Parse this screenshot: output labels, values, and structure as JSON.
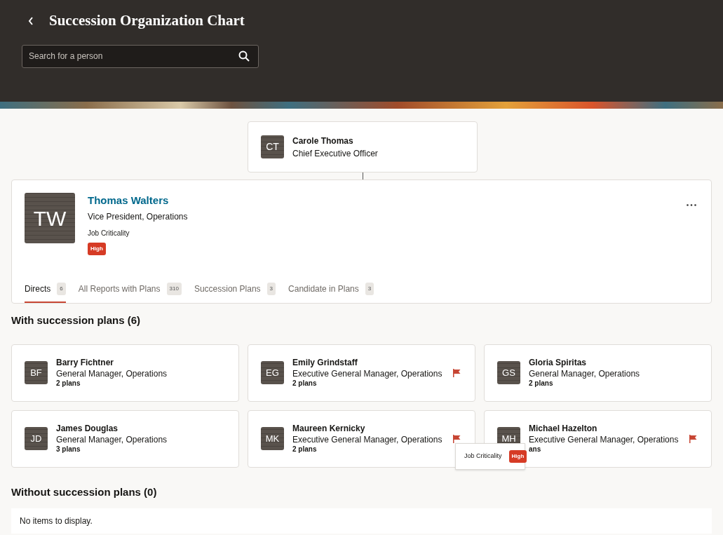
{
  "header": {
    "title": "Succession Organization Chart",
    "search": {
      "placeholder": "Search for a person"
    }
  },
  "manager": {
    "initials": "CT",
    "name": "Carole Thomas",
    "title": "Chief Executive Officer"
  },
  "person": {
    "initials": "TW",
    "name": "Thomas Walters",
    "title": "Vice President, Operations",
    "criticality_label": "Job Criticality",
    "criticality": "High"
  },
  "tabs": [
    {
      "label": "Directs",
      "count": "6",
      "selected": true
    },
    {
      "label": "All Reports with Plans",
      "count": "310",
      "selected": false
    },
    {
      "label": "Succession Plans",
      "count": "3",
      "selected": false
    },
    {
      "label": "Candidate in Plans",
      "count": "3",
      "selected": false
    }
  ],
  "with_plans": {
    "heading": "With succession plans (6)",
    "items": [
      {
        "initials": "BF",
        "name": "Barry Fichtner",
        "title": "General Manager, Operations",
        "plans": "2 plans",
        "flagged": false
      },
      {
        "initials": "EG",
        "name": "Emily Grindstaff",
        "title": "Executive General Manager, Operations",
        "plans": "2 plans",
        "flagged": true
      },
      {
        "initials": "GS",
        "name": "Gloria Spiritas",
        "title": "General Manager, Operations",
        "plans": "2 plans",
        "flagged": false
      },
      {
        "initials": "JD",
        "name": "James Douglas",
        "title": "General Manager, Operations",
        "plans": "3 plans",
        "flagged": false
      },
      {
        "initials": "MK",
        "name": "Maureen Kernicky",
        "title": "Executive General Manager, Operations",
        "plans": "2 plans",
        "flagged": true
      },
      {
        "initials": "MH",
        "name": "Michael Hazelton",
        "title": "Executive General Manager, Operations",
        "plans": "ans",
        "flagged": true
      }
    ]
  },
  "tooltip": {
    "label": "Job Criticality",
    "badge": "High"
  },
  "without_plans": {
    "heading": "Without succession plans (0)",
    "empty": "No items to display."
  }
}
